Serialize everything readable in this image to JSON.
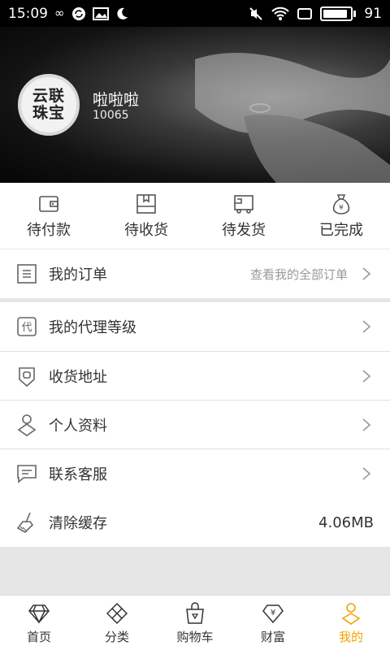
{
  "status_bar": {
    "time": "15:09",
    "battery": "91",
    "battery_level": 0.91
  },
  "profile": {
    "logo_line1": "云联",
    "logo_line2": "珠宝",
    "name": "啦啦啦",
    "id": "10065"
  },
  "order_status": [
    {
      "label": "待付款",
      "icon": "wallet-icon"
    },
    {
      "label": "待收货",
      "icon": "box-icon"
    },
    {
      "label": "待发货",
      "icon": "truck-icon"
    },
    {
      "label": "已完成",
      "icon": "money-bag-icon"
    }
  ],
  "my_orders": {
    "label": "我的订单",
    "link": "查看我的全部订单"
  },
  "menu": [
    {
      "label": "我的代理等级",
      "icon": "agent-level-icon"
    },
    {
      "label": "收货地址",
      "icon": "location-icon"
    },
    {
      "label": "个人资料",
      "icon": "person-icon"
    },
    {
      "label": "联系客服",
      "icon": "message-icon"
    }
  ],
  "cache": {
    "label": "清除缓存",
    "value": "4.06MB"
  },
  "tabs": [
    {
      "label": "首页",
      "icon": "diamond-icon"
    },
    {
      "label": "分类",
      "icon": "clover-icon"
    },
    {
      "label": "购物车",
      "icon": "shopping-bag-icon"
    },
    {
      "label": "财富",
      "icon": "yuan-diamond-icon"
    },
    {
      "label": "我的",
      "icon": "user-icon",
      "active": true
    }
  ],
  "colors": {
    "accent": "#f0a500",
    "text": "#333333",
    "muted": "#999999",
    "background": "#e6e6e6"
  }
}
